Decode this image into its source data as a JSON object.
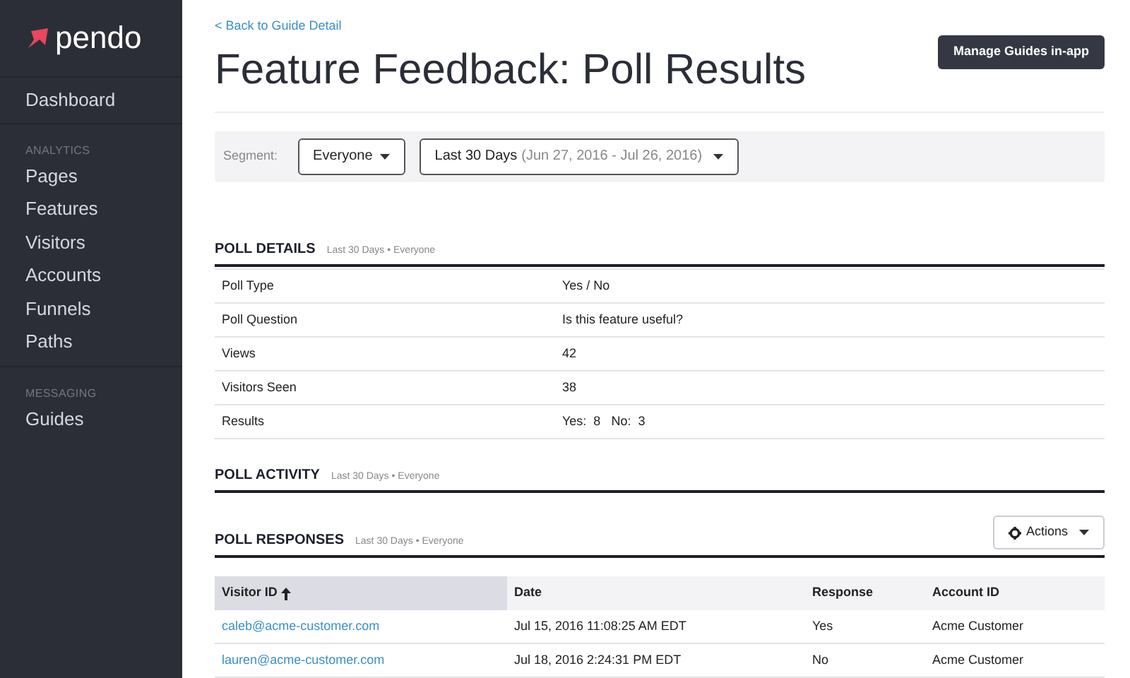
{
  "sidebar": {
    "logo": "pendo",
    "sections": [
      {
        "items": [
          {
            "label": "Dashboard"
          }
        ]
      },
      {
        "heading": "ANALYTICS",
        "items": [
          {
            "label": "Pages"
          },
          {
            "label": "Features"
          },
          {
            "label": "Visitors"
          },
          {
            "label": "Accounts"
          },
          {
            "label": "Funnels"
          },
          {
            "label": "Paths"
          }
        ]
      },
      {
        "heading": "MESSAGING",
        "items": [
          {
            "label": "Guides"
          }
        ]
      }
    ]
  },
  "back_link": "< Back to Guide Detail",
  "title": "Feature Feedback: Poll Results",
  "manage_button": "Manage Guides in-app",
  "filters": {
    "label": "Segment:",
    "segment": "Everyone",
    "range": "Last 30 Days",
    "range_detail": "(Jun 27, 2016 - Jul 26, 2016)"
  },
  "poll_details": {
    "heading": "POLL DETAILS",
    "subtitle": "Last 30 Days • Everyone",
    "rows": [
      {
        "label": "Poll Type",
        "value": "Yes / No"
      },
      {
        "label": "Poll Question",
        "value": "Is this feature useful?"
      },
      {
        "label": "Views",
        "value": "42"
      },
      {
        "label": "Visitors Seen",
        "value": "38"
      },
      {
        "label": "Results",
        "value": "Yes:  8   No:  3"
      }
    ]
  },
  "poll_activity": {
    "heading": "POLL ACTIVITY",
    "subtitle": "Last 30 Days • Everyone"
  },
  "actions_button": "Actions",
  "poll_responses": {
    "heading": "POLL RESPONSES",
    "subtitle": "Last 30 Days • Everyone",
    "columns": [
      {
        "label": "Visitor ID",
        "sorted": true
      },
      {
        "label": "Date",
        "sorted": false
      },
      {
        "label": "Response",
        "sorted": false
      },
      {
        "label": "Account ID",
        "sorted": false
      }
    ],
    "rows": [
      [
        "caleb@acme-customer.com",
        "Jul 15, 2016 11:08:25 AM EDT",
        "Yes",
        "Acme Customer"
      ],
      [
        "lauren@acme-customer.com",
        "Jul 18, 2016 2:24:31 PM EDT",
        "No",
        "Acme Customer"
      ]
    ]
  }
}
